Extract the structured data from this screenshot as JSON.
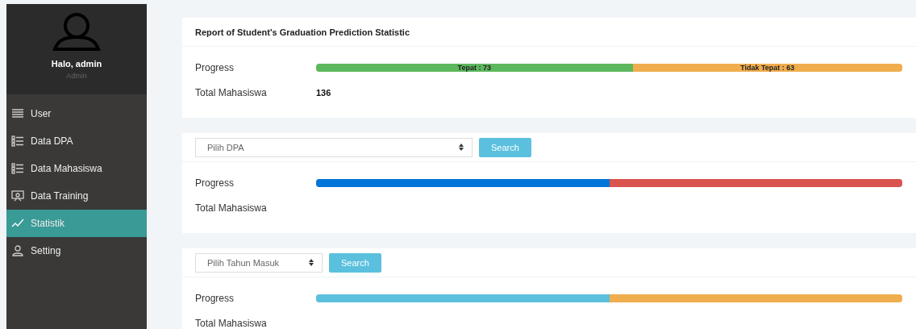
{
  "sidebar": {
    "user": {
      "greeting": "Halo, admin",
      "role": "Admin"
    },
    "items": [
      {
        "label": "User",
        "selected": false
      },
      {
        "label": "Data DPA",
        "selected": false
      },
      {
        "label": "Data Mahasiswa",
        "selected": false
      },
      {
        "label": "Data Training",
        "selected": false
      },
      {
        "label": "Statistik",
        "selected": true
      },
      {
        "label": "Setting",
        "selected": false
      }
    ]
  },
  "panels": [
    {
      "kind": "title",
      "title": "Report of Student's Graduation Prediction Statistic",
      "progress_label": "Progress",
      "segments": [
        {
          "level": 0.54,
          "color": "#5cb85c",
          "label": "Tepat : 73"
        },
        {
          "level": 0.46,
          "color": "#f0ad4e",
          "label": "Tidak Tepat : 63"
        }
      ],
      "total_label": "Total Mahasiswa",
      "total": "136"
    },
    {
      "kind": "filter",
      "select": "Pilih DPA",
      "button": "Search",
      "progress_label": "Progress",
      "segments": [
        {
          "level": 0.5,
          "color": "#0275d8"
        },
        {
          "level": 0.5,
          "color": "#d9534f"
        }
      ],
      "total_label": "Total Mahasiswa"
    },
    {
      "kind": "filter",
      "select": "Pilih Tahun Masuk",
      "button": "Search",
      "progress_label": "Progress",
      "segments": [
        {
          "level": 0.5,
          "color": "#5bc0de"
        },
        {
          "level": 0.5,
          "color": "#f0ad4e"
        }
      ],
      "total_label": "Total Mahasiswa"
    }
  ]
}
